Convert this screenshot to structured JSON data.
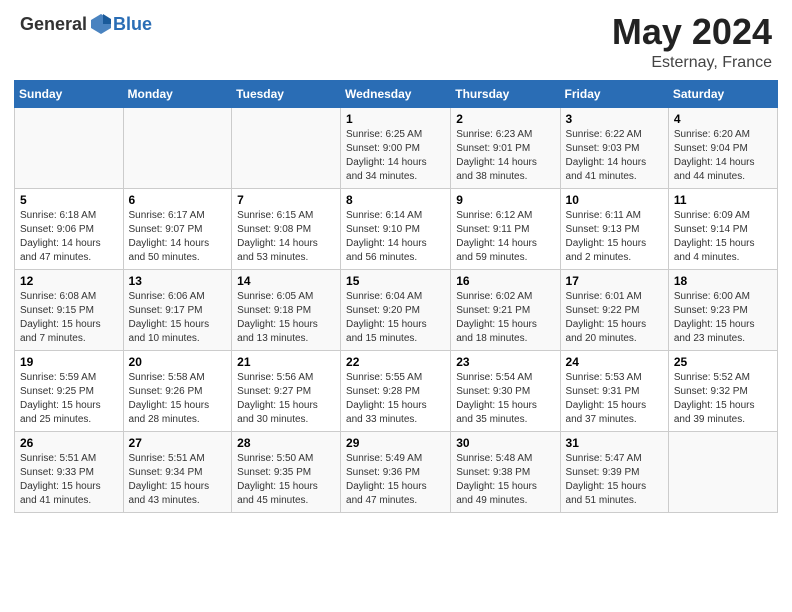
{
  "header": {
    "logo_general": "General",
    "logo_blue": "Blue",
    "title": "May 2024",
    "location": "Esternay, France"
  },
  "calendar": {
    "days_of_week": [
      "Sunday",
      "Monday",
      "Tuesday",
      "Wednesday",
      "Thursday",
      "Friday",
      "Saturday"
    ],
    "weeks": [
      [
        {
          "day": "",
          "info": ""
        },
        {
          "day": "",
          "info": ""
        },
        {
          "day": "",
          "info": ""
        },
        {
          "day": "1",
          "info": "Sunrise: 6:25 AM\nSunset: 9:00 PM\nDaylight: 14 hours and 34 minutes."
        },
        {
          "day": "2",
          "info": "Sunrise: 6:23 AM\nSunset: 9:01 PM\nDaylight: 14 hours and 38 minutes."
        },
        {
          "day": "3",
          "info": "Sunrise: 6:22 AM\nSunset: 9:03 PM\nDaylight: 14 hours and 41 minutes."
        },
        {
          "day": "4",
          "info": "Sunrise: 6:20 AM\nSunset: 9:04 PM\nDaylight: 14 hours and 44 minutes."
        }
      ],
      [
        {
          "day": "5",
          "info": "Sunrise: 6:18 AM\nSunset: 9:06 PM\nDaylight: 14 hours and 47 minutes."
        },
        {
          "day": "6",
          "info": "Sunrise: 6:17 AM\nSunset: 9:07 PM\nDaylight: 14 hours and 50 minutes."
        },
        {
          "day": "7",
          "info": "Sunrise: 6:15 AM\nSunset: 9:08 PM\nDaylight: 14 hours and 53 minutes."
        },
        {
          "day": "8",
          "info": "Sunrise: 6:14 AM\nSunset: 9:10 PM\nDaylight: 14 hours and 56 minutes."
        },
        {
          "day": "9",
          "info": "Sunrise: 6:12 AM\nSunset: 9:11 PM\nDaylight: 14 hours and 59 minutes."
        },
        {
          "day": "10",
          "info": "Sunrise: 6:11 AM\nSunset: 9:13 PM\nDaylight: 15 hours and 2 minutes."
        },
        {
          "day": "11",
          "info": "Sunrise: 6:09 AM\nSunset: 9:14 PM\nDaylight: 15 hours and 4 minutes."
        }
      ],
      [
        {
          "day": "12",
          "info": "Sunrise: 6:08 AM\nSunset: 9:15 PM\nDaylight: 15 hours and 7 minutes."
        },
        {
          "day": "13",
          "info": "Sunrise: 6:06 AM\nSunset: 9:17 PM\nDaylight: 15 hours and 10 minutes."
        },
        {
          "day": "14",
          "info": "Sunrise: 6:05 AM\nSunset: 9:18 PM\nDaylight: 15 hours and 13 minutes."
        },
        {
          "day": "15",
          "info": "Sunrise: 6:04 AM\nSunset: 9:20 PM\nDaylight: 15 hours and 15 minutes."
        },
        {
          "day": "16",
          "info": "Sunrise: 6:02 AM\nSunset: 9:21 PM\nDaylight: 15 hours and 18 minutes."
        },
        {
          "day": "17",
          "info": "Sunrise: 6:01 AM\nSunset: 9:22 PM\nDaylight: 15 hours and 20 minutes."
        },
        {
          "day": "18",
          "info": "Sunrise: 6:00 AM\nSunset: 9:23 PM\nDaylight: 15 hours and 23 minutes."
        }
      ],
      [
        {
          "day": "19",
          "info": "Sunrise: 5:59 AM\nSunset: 9:25 PM\nDaylight: 15 hours and 25 minutes."
        },
        {
          "day": "20",
          "info": "Sunrise: 5:58 AM\nSunset: 9:26 PM\nDaylight: 15 hours and 28 minutes."
        },
        {
          "day": "21",
          "info": "Sunrise: 5:56 AM\nSunset: 9:27 PM\nDaylight: 15 hours and 30 minutes."
        },
        {
          "day": "22",
          "info": "Sunrise: 5:55 AM\nSunset: 9:28 PM\nDaylight: 15 hours and 33 minutes."
        },
        {
          "day": "23",
          "info": "Sunrise: 5:54 AM\nSunset: 9:30 PM\nDaylight: 15 hours and 35 minutes."
        },
        {
          "day": "24",
          "info": "Sunrise: 5:53 AM\nSunset: 9:31 PM\nDaylight: 15 hours and 37 minutes."
        },
        {
          "day": "25",
          "info": "Sunrise: 5:52 AM\nSunset: 9:32 PM\nDaylight: 15 hours and 39 minutes."
        }
      ],
      [
        {
          "day": "26",
          "info": "Sunrise: 5:51 AM\nSunset: 9:33 PM\nDaylight: 15 hours and 41 minutes."
        },
        {
          "day": "27",
          "info": "Sunrise: 5:51 AM\nSunset: 9:34 PM\nDaylight: 15 hours and 43 minutes."
        },
        {
          "day": "28",
          "info": "Sunrise: 5:50 AM\nSunset: 9:35 PM\nDaylight: 15 hours and 45 minutes."
        },
        {
          "day": "29",
          "info": "Sunrise: 5:49 AM\nSunset: 9:36 PM\nDaylight: 15 hours and 47 minutes."
        },
        {
          "day": "30",
          "info": "Sunrise: 5:48 AM\nSunset: 9:38 PM\nDaylight: 15 hours and 49 minutes."
        },
        {
          "day": "31",
          "info": "Sunrise: 5:47 AM\nSunset: 9:39 PM\nDaylight: 15 hours and 51 minutes."
        },
        {
          "day": "",
          "info": ""
        }
      ]
    ]
  }
}
